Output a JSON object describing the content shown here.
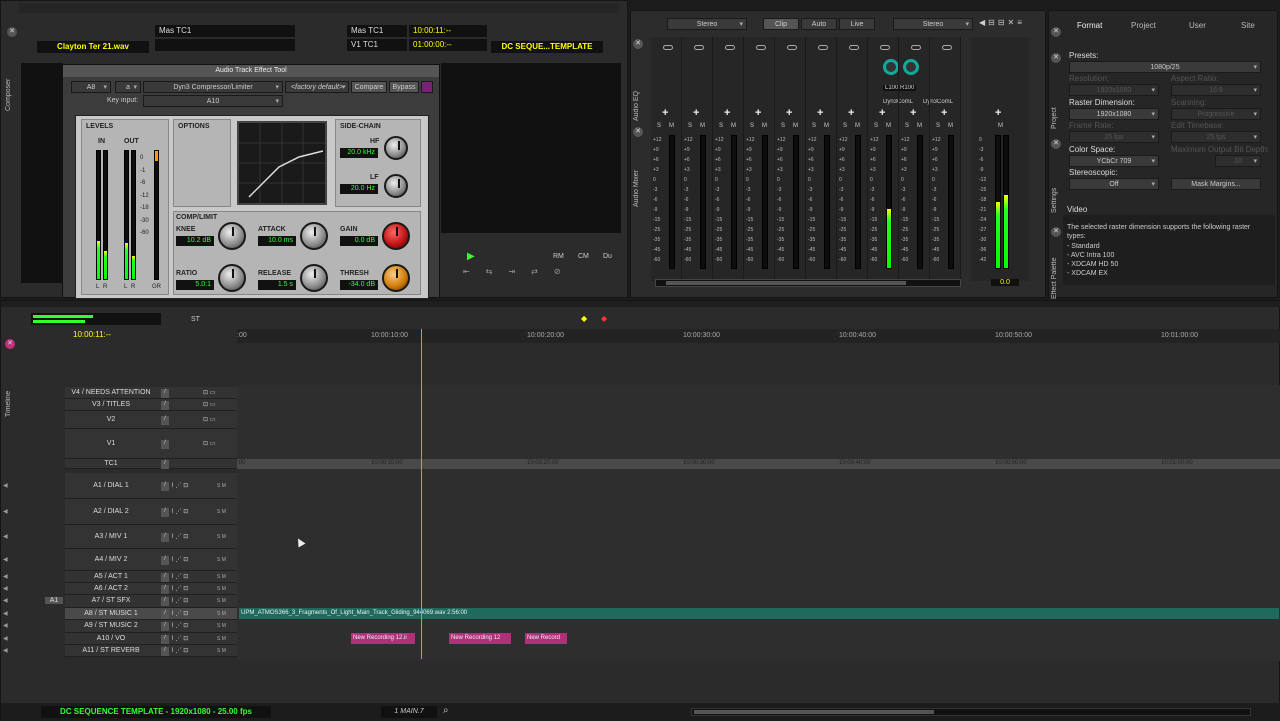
{
  "composer": {
    "tab_label": "Composer",
    "clip_name": "Clayton Ter 21.wav",
    "mas_tc1_left": "Mas  TC1",
    "mas_tc1_right": "Mas  TC1",
    "mas_tc1_value": "10:00:11:--",
    "v1_tc1": "V1  TC1",
    "v1_tc1_value": "01:00:00:--",
    "sequence_name": "DC SEQUE...TEMPLATE",
    "transport": [
      "RM",
      "CM",
      "Du"
    ]
  },
  "effect_tool": {
    "title": "Audio Track Effect Tool",
    "track": "A8",
    "slot": "a",
    "plugin": "Dyn3 Compressor/Limiter",
    "preset": "<factory default>",
    "compare": "Compare",
    "bypass": "Bypass",
    "key_input_label": "Key input:",
    "key_input_value": "A10",
    "levels_label": "LEVELS",
    "in_label": "IN",
    "out_label": "OUT",
    "options_label": "OPTIONS",
    "sidechain_label": "SIDE-CHAIN",
    "hf_label": "HF",
    "hf_value": "20.0 kHz",
    "lf_label": "LF",
    "lf_value": "20.0 Hz",
    "comp_label": "COMP/LIMIT",
    "knee_label": "KNEE",
    "knee_value": "10.2 dB",
    "attack_label": "ATTACK",
    "attack_value": "10.0 ms",
    "gain_label": "GAIN",
    "gain_value": "0.0 dB",
    "ratio_label": "RATIO",
    "ratio_value": "5.0:1",
    "release_label": "RELEASE",
    "release_value": "1.5 s",
    "thresh_label": "THRESH",
    "thresh_value": "-34.0 dB",
    "meter_scale": [
      "0",
      "-1",
      "-6",
      "-12",
      "-18",
      "-30",
      "-60"
    ],
    "meter_foot": [
      "L",
      "R",
      "L",
      "R",
      "GR"
    ]
  },
  "mixer": {
    "tab_eq": "Audio EQ",
    "tab_mixer": "Audio Mixer",
    "left_mode": "Stereo",
    "tabs": [
      "Clip",
      "Auto",
      "Live"
    ],
    "right_mode": "Stereo",
    "insert_names": [
      "Dyn3ComL",
      "Dyn3ComL"
    ],
    "pan_values": "L100  R100",
    "scale": [
      "+12",
      "+9",
      "+6",
      "+3",
      "0",
      "-3",
      "-6",
      "-9",
      "-15",
      "-25",
      "-35",
      "-45",
      "-60"
    ],
    "master_scale": [
      "0",
      "-3",
      "-6",
      "-9",
      "-12",
      "-15",
      "-18",
      "-21",
      "-24",
      "-27",
      "-30",
      "-36",
      "-42"
    ],
    "master_value": "0.0",
    "channel_meter_levels": [
      0,
      0,
      0,
      0,
      0,
      0,
      0,
      0.45,
      0,
      0
    ],
    "master_meter_levels": [
      0.5,
      0.55
    ]
  },
  "settings": {
    "tabs": [
      "Format",
      "Project",
      "User",
      "Site"
    ],
    "presets_label": "Presets:",
    "presets_value": "1080p/25",
    "resolution_label": "Resolution:",
    "resolution_value": "1920x1080",
    "aspect_label": "Aspect Ratio:",
    "aspect_value": "16:9",
    "raster_label": "Raster Dimension:",
    "raster_value": "1920x1080",
    "scanning_label": "Scanning:",
    "scanning_value": "Progressive",
    "frame_rate_label": "Frame Rate:",
    "frame_rate_value": "25 fps",
    "edit_timebase_label": "Edit Timebase:",
    "edit_timebase_value": "25 fps",
    "color_space_label": "Color Space:",
    "color_space_value": "YCbCr 709",
    "max_depth_label": "Maximum Output Bit Depth:",
    "max_depth_value": "10",
    "stereoscopic_label": "Stereoscopic:",
    "stereoscopic_value": "Off",
    "mask_margins": "Mask Margins...",
    "video_label": "Video",
    "video_text": "The selected raster dimension supports the following raster types:",
    "video_types": [
      "- Standard",
      "- AVC Intra 100",
      "- XDCAM HD 50",
      "- XDCAM EX"
    ],
    "side_tabs": [
      "Project",
      "Settings",
      "Effect Palette"
    ]
  },
  "timeline": {
    "tab_label": "Timeline",
    "st_label": "ST",
    "timecode": "10:00:11:--",
    "ruler": [
      ":00",
      "10:00:10:00",
      "10:00:20:00",
      "10:00:30:00",
      "10:00:40:00",
      "10:00:50:00",
      "10:01:00:00"
    ],
    "tc_ruler": [
      ":00",
      "10:00:10:00",
      "10:00:20:00",
      "10:00:30:00",
      "10:00:40:00",
      "10:00:50:00",
      "10:01:00:00"
    ],
    "tracks": [
      "V4 / NEEDS ATTENTION",
      "V3 / TITLES",
      "V2",
      "V1",
      "TC1",
      "A1 / DIAL 1",
      "A2 / DIAL 2",
      "A3 / MIV 1",
      "A4 / MIV 2",
      "A5 / ACT 1",
      "A6 / ACT 2",
      "A7 / ST SFX",
      "A8 / ST MUSIC 1",
      "A9 / ST MUSIC 2",
      "A10 / VO",
      "A11 / ST REVERB"
    ],
    "a1_patch": "A1",
    "music_clip": "UPM_ATMOS366_3_Fragments_Of_Light_Main_Track_Gliding_944069.wav 2:56:00",
    "vo_clips": [
      "New Recording 12.ii",
      "New Recording 12",
      "New Record"
    ],
    "status": "DC SEQUENCE TEMPLATE - 1920x1080 - 25.00 fps",
    "zoom_label": "1 MAIN.7"
  },
  "colors": {
    "accent_green": "#33ff33",
    "clip_teal": "#1e6b5e",
    "clip_pink": "#b0307a",
    "playhead": "#3cc"
  }
}
